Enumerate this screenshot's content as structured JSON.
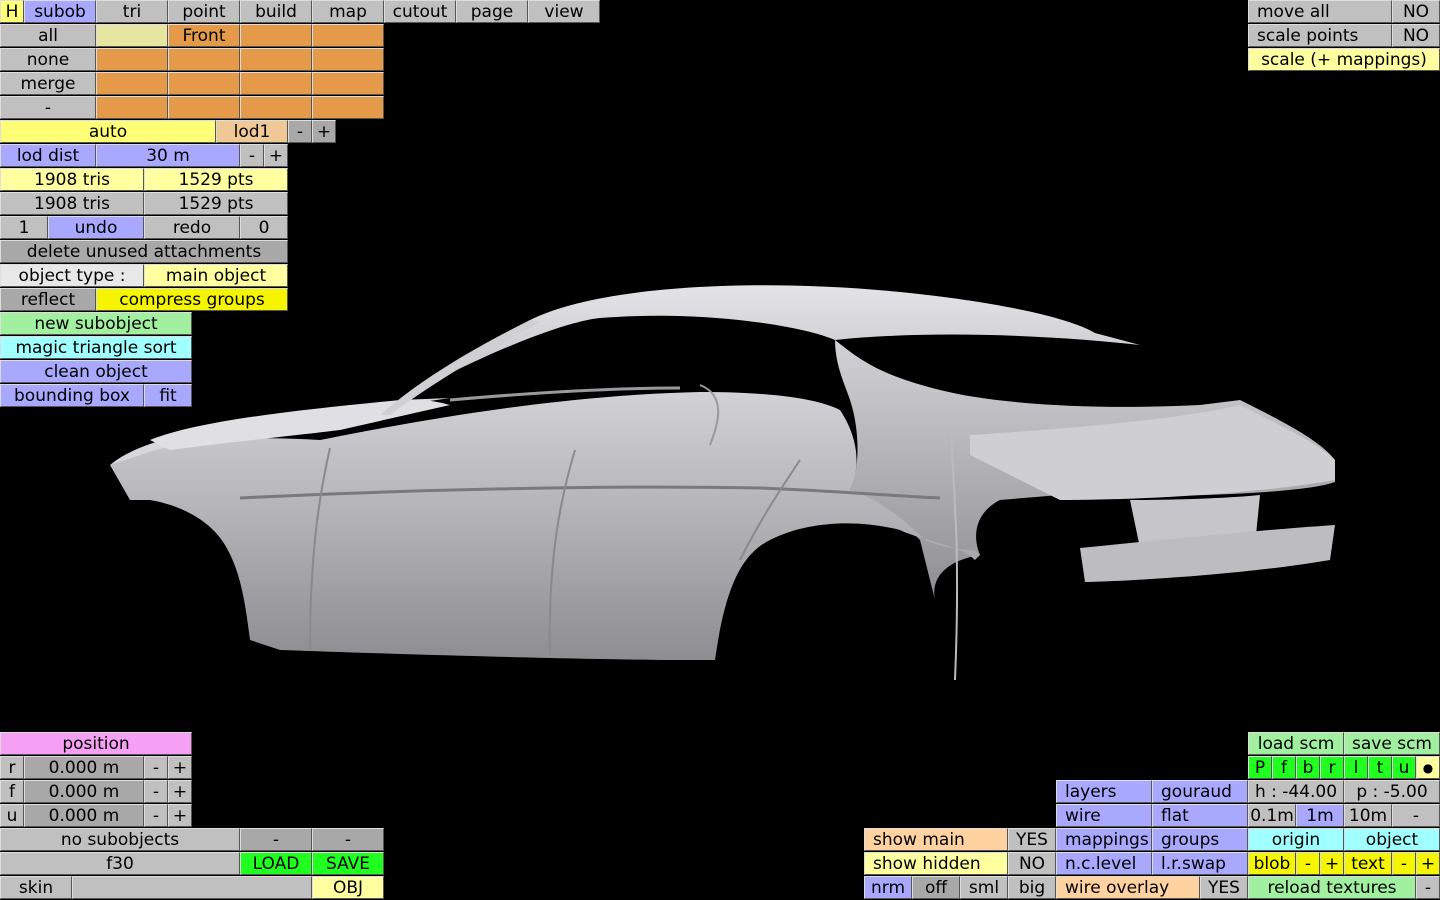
{
  "menu": {
    "h": "H",
    "tabs": [
      "subob",
      "tri",
      "point",
      "build",
      "map",
      "cutout",
      "page",
      "view"
    ]
  },
  "selection": {
    "all": "all",
    "none": "none",
    "merge": "merge",
    "dash": "-",
    "front": "Front"
  },
  "lod": {
    "auto": "auto",
    "name": "lod1",
    "minus": "-",
    "plus": "+",
    "dist_label": "lod dist",
    "dist_value": "30 m"
  },
  "stats": {
    "row1_tris": "1908 tris",
    "row1_pts": "1529 pts",
    "row2_tris": "1908 tris",
    "row2_pts": "1529 pts"
  },
  "history": {
    "undo_count": "1",
    "undo": "undo",
    "redo": "redo",
    "redo_count": "0"
  },
  "actions": {
    "delete_unused": "delete unused attachments",
    "object_type_label": "object type :",
    "object_type_value": "main object",
    "reflect": "reflect",
    "compress_groups": "compress groups",
    "new_subobject": "new subobject",
    "magic_sort": "magic triangle sort",
    "clean_object": "clean object",
    "bounding_box": "bounding box",
    "fit": "fit"
  },
  "transform": {
    "move_all": "move all",
    "move_all_value": "NO",
    "scale_points": "scale points",
    "scale_points_value": "NO",
    "scale_mappings": "scale (+ mappings)"
  },
  "position": {
    "title": "position",
    "rows": [
      {
        "axis": "r",
        "value": "0.000 m"
      },
      {
        "axis": "f",
        "value": "0.000 m"
      },
      {
        "axis": "u",
        "value": "0.000 m"
      }
    ],
    "minus": "-",
    "plus": "+"
  },
  "subobjects": {
    "none": "no subobjects",
    "dash1": "-",
    "dash2": "-",
    "file": "f30",
    "load": "LOAD",
    "save": "SAVE",
    "skin": "skin",
    "obj": "OBJ"
  },
  "display": {
    "show_main": "show main",
    "show_main_value": "YES",
    "show_hidden": "show hidden",
    "show_hidden_value": "NO",
    "nrm": "nrm",
    "off": "off",
    "sml": "sml",
    "big": "big",
    "layers": "layers",
    "gouraud": "gouraud",
    "wire": "wire",
    "flat": "flat",
    "mappings": "mappings",
    "groups": "groups",
    "nc_level": "n.c.level",
    "lr_swap": "l.r.swap",
    "wire_overlay": "wire overlay",
    "wire_overlay_value": "YES"
  },
  "file": {
    "load_scm": "load scm",
    "save_scm": "save scm",
    "views": [
      "P",
      "f",
      "b",
      "r",
      "l",
      "t",
      "u"
    ],
    "dot": "●",
    "heading": "h : -44.00",
    "pitch": "p : -5.00",
    "step1": "0.1m",
    "step2": "1m",
    "step3": "10m",
    "step_minus": "-",
    "origin": "origin",
    "object": "object",
    "blob": "blob",
    "text": "text",
    "minus": "-",
    "plus": "+",
    "reload_textures": "reload textures"
  },
  "colors": {
    "background": "#000000",
    "car_body": "#b8b8bc"
  }
}
